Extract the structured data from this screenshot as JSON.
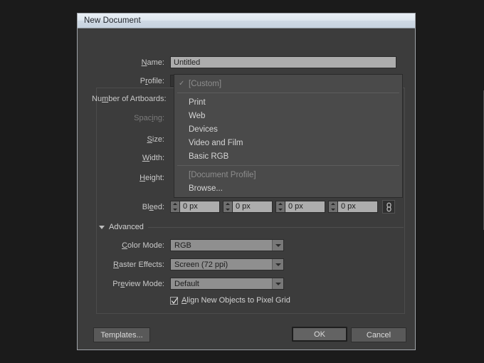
{
  "window": {
    "title": "New Document"
  },
  "fields": {
    "name": {
      "label_pre": "N",
      "label_accel": "a",
      "label_post": "me:",
      "label_full": "Name:",
      "value": "Untitled"
    },
    "profile": {
      "label_full": "Profile:",
      "value": "[Custom]"
    },
    "number_of_artboards": {
      "label_full": "Number of Artboards:"
    },
    "spacing": {
      "label_full": "Spacing:"
    },
    "size": {
      "label_full": "Size:"
    },
    "width": {
      "label_full": "Width:"
    },
    "height": {
      "label_full": "Height:"
    },
    "bleed": {
      "label_full": "Bleed:",
      "top": "0 px",
      "bottom": "0 px",
      "left": "0 px",
      "right": "0 px",
      "link_icon": "chain-link-icon"
    }
  },
  "profile_dropdown": {
    "open": true,
    "items": [
      {
        "label": "[Custom]",
        "checked": true,
        "disabled": true,
        "separator_after": true
      },
      {
        "label": "Print",
        "checked": false,
        "disabled": false,
        "separator_after": false
      },
      {
        "label": "Web",
        "checked": false,
        "disabled": false,
        "separator_after": false
      },
      {
        "label": "Devices",
        "checked": false,
        "disabled": false,
        "separator_after": false
      },
      {
        "label": "Video and Film",
        "checked": false,
        "disabled": false,
        "separator_after": false
      },
      {
        "label": "Basic RGB",
        "checked": false,
        "disabled": false,
        "separator_after": true
      },
      {
        "label": "[Document Profile]",
        "checked": false,
        "disabled": true,
        "separator_after": false
      },
      {
        "label": "Browse...",
        "checked": false,
        "disabled": false,
        "separator_after": false
      }
    ]
  },
  "advanced": {
    "section_label": "Advanced",
    "expanded": true,
    "color_mode": {
      "label_full": "Color Mode:",
      "value": "RGB"
    },
    "raster_effects": {
      "label_full": "Raster Effects:",
      "value": "Screen (72 ppi)"
    },
    "preview_mode": {
      "label_full": "Preview Mode:",
      "value": "Default"
    },
    "align_pixel_grid": {
      "label_full": "Align New Objects to Pixel Grid",
      "checked": true
    }
  },
  "buttons": {
    "templates": "Templates...",
    "ok": "OK",
    "cancel": "Cancel"
  },
  "colors": {
    "dialog_bg": "#3c3c3c",
    "titlebar_text": "#20242b",
    "field_light": "#adadad",
    "combo_dark": "#333333",
    "dropdown_bg": "#4a4a4a",
    "text": "#c8c8c8",
    "text_dim": "#7b7b7b"
  }
}
